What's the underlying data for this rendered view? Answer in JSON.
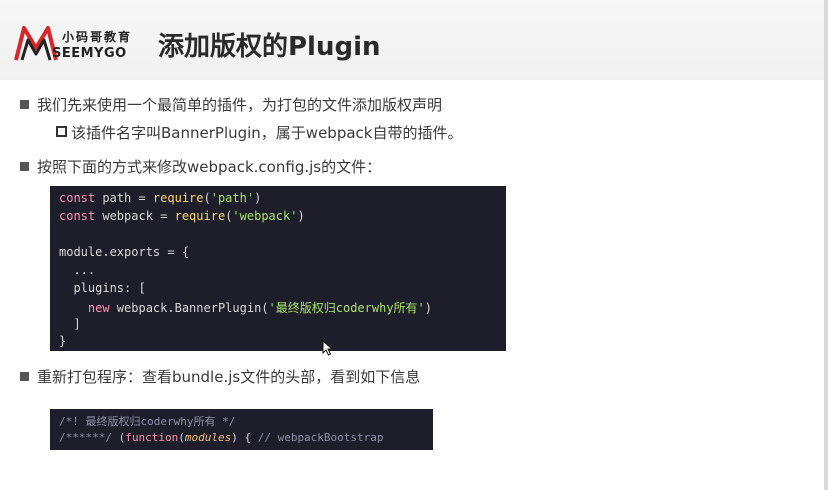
{
  "header": {
    "logo_cn": "小码哥教育",
    "logo_en": "SEEMYGO",
    "title": "添加版权的Plugin"
  },
  "bullets": {
    "b1": "我们先来使用一个最简单的插件，为打包的文件添加版权声明",
    "b1_sub": "该插件名字叫BannerPlugin，属于webpack自带的插件。",
    "b2": "按照下面的方式来修改webpack.config.js的文件：",
    "b3": "重新打包程序：查看bundle.js文件的头部，看到如下信息"
  },
  "code1": {
    "l1_kw": "const",
    "l1_var": " path = ",
    "l1_fn": "require",
    "l1_open": "(",
    "l1_str": "'path'",
    "l1_close": ")",
    "l2_kw": "const",
    "l2_var": " webpack = ",
    "l2_fn": "require",
    "l2_open": "(",
    "l2_str": "'webpack'",
    "l2_close": ")",
    "l3": "module.exports = {",
    "l4": "  ...",
    "l5": "  plugins: [",
    "l6_kw": "    new",
    "l6_call": " webpack.BannerPlugin(",
    "l6_str": "'最终版权归coderwhy所有'",
    "l6_close": ")",
    "l7": "  ]",
    "l8": "}"
  },
  "code2": {
    "l1": "/*! 最终版权归coderwhy所有 */",
    "l2_cm": "/******/",
    "l2_open": " (",
    "l2_kw": "function",
    "l2_po": "(",
    "l2_param": "modules",
    "l2_pc": ") { ",
    "l2_cm2": "// webpackBootstrap"
  },
  "colors": {
    "code_bg": "#1e1e2a",
    "keyword": "#ff8fb4",
    "function": "#ffd866",
    "string": "#a8e26a",
    "comment": "#8e8ea8",
    "logo_red": "#d9262b"
  },
  "icons": {
    "logo": "seemygo-m-logo-icon",
    "pointer": "mouse-pointer-icon"
  }
}
